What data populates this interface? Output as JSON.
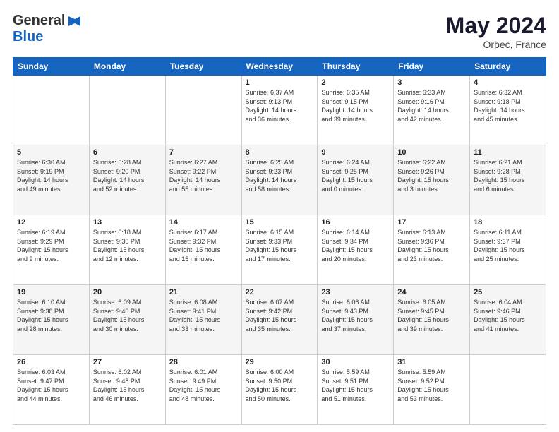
{
  "header": {
    "logo_general": "General",
    "logo_blue": "Blue",
    "month": "May 2024",
    "location": "Orbec, France"
  },
  "days_of_week": [
    "Sunday",
    "Monday",
    "Tuesday",
    "Wednesday",
    "Thursday",
    "Friday",
    "Saturday"
  ],
  "weeks": [
    [
      {
        "num": "",
        "detail": ""
      },
      {
        "num": "",
        "detail": ""
      },
      {
        "num": "",
        "detail": ""
      },
      {
        "num": "1",
        "detail": "Sunrise: 6:37 AM\nSunset: 9:13 PM\nDaylight: 14 hours\nand 36 minutes."
      },
      {
        "num": "2",
        "detail": "Sunrise: 6:35 AM\nSunset: 9:15 PM\nDaylight: 14 hours\nand 39 minutes."
      },
      {
        "num": "3",
        "detail": "Sunrise: 6:33 AM\nSunset: 9:16 PM\nDaylight: 14 hours\nand 42 minutes."
      },
      {
        "num": "4",
        "detail": "Sunrise: 6:32 AM\nSunset: 9:18 PM\nDaylight: 14 hours\nand 45 minutes."
      }
    ],
    [
      {
        "num": "5",
        "detail": "Sunrise: 6:30 AM\nSunset: 9:19 PM\nDaylight: 14 hours\nand 49 minutes."
      },
      {
        "num": "6",
        "detail": "Sunrise: 6:28 AM\nSunset: 9:20 PM\nDaylight: 14 hours\nand 52 minutes."
      },
      {
        "num": "7",
        "detail": "Sunrise: 6:27 AM\nSunset: 9:22 PM\nDaylight: 14 hours\nand 55 minutes."
      },
      {
        "num": "8",
        "detail": "Sunrise: 6:25 AM\nSunset: 9:23 PM\nDaylight: 14 hours\nand 58 minutes."
      },
      {
        "num": "9",
        "detail": "Sunrise: 6:24 AM\nSunset: 9:25 PM\nDaylight: 15 hours\nand 0 minutes."
      },
      {
        "num": "10",
        "detail": "Sunrise: 6:22 AM\nSunset: 9:26 PM\nDaylight: 15 hours\nand 3 minutes."
      },
      {
        "num": "11",
        "detail": "Sunrise: 6:21 AM\nSunset: 9:28 PM\nDaylight: 15 hours\nand 6 minutes."
      }
    ],
    [
      {
        "num": "12",
        "detail": "Sunrise: 6:19 AM\nSunset: 9:29 PM\nDaylight: 15 hours\nand 9 minutes."
      },
      {
        "num": "13",
        "detail": "Sunrise: 6:18 AM\nSunset: 9:30 PM\nDaylight: 15 hours\nand 12 minutes."
      },
      {
        "num": "14",
        "detail": "Sunrise: 6:17 AM\nSunset: 9:32 PM\nDaylight: 15 hours\nand 15 minutes."
      },
      {
        "num": "15",
        "detail": "Sunrise: 6:15 AM\nSunset: 9:33 PM\nDaylight: 15 hours\nand 17 minutes."
      },
      {
        "num": "16",
        "detail": "Sunrise: 6:14 AM\nSunset: 9:34 PM\nDaylight: 15 hours\nand 20 minutes."
      },
      {
        "num": "17",
        "detail": "Sunrise: 6:13 AM\nSunset: 9:36 PM\nDaylight: 15 hours\nand 23 minutes."
      },
      {
        "num": "18",
        "detail": "Sunrise: 6:11 AM\nSunset: 9:37 PM\nDaylight: 15 hours\nand 25 minutes."
      }
    ],
    [
      {
        "num": "19",
        "detail": "Sunrise: 6:10 AM\nSunset: 9:38 PM\nDaylight: 15 hours\nand 28 minutes."
      },
      {
        "num": "20",
        "detail": "Sunrise: 6:09 AM\nSunset: 9:40 PM\nDaylight: 15 hours\nand 30 minutes."
      },
      {
        "num": "21",
        "detail": "Sunrise: 6:08 AM\nSunset: 9:41 PM\nDaylight: 15 hours\nand 33 minutes."
      },
      {
        "num": "22",
        "detail": "Sunrise: 6:07 AM\nSunset: 9:42 PM\nDaylight: 15 hours\nand 35 minutes."
      },
      {
        "num": "23",
        "detail": "Sunrise: 6:06 AM\nSunset: 9:43 PM\nDaylight: 15 hours\nand 37 minutes."
      },
      {
        "num": "24",
        "detail": "Sunrise: 6:05 AM\nSunset: 9:45 PM\nDaylight: 15 hours\nand 39 minutes."
      },
      {
        "num": "25",
        "detail": "Sunrise: 6:04 AM\nSunset: 9:46 PM\nDaylight: 15 hours\nand 41 minutes."
      }
    ],
    [
      {
        "num": "26",
        "detail": "Sunrise: 6:03 AM\nSunset: 9:47 PM\nDaylight: 15 hours\nand 44 minutes."
      },
      {
        "num": "27",
        "detail": "Sunrise: 6:02 AM\nSunset: 9:48 PM\nDaylight: 15 hours\nand 46 minutes."
      },
      {
        "num": "28",
        "detail": "Sunrise: 6:01 AM\nSunset: 9:49 PM\nDaylight: 15 hours\nand 48 minutes."
      },
      {
        "num": "29",
        "detail": "Sunrise: 6:00 AM\nSunset: 9:50 PM\nDaylight: 15 hours\nand 50 minutes."
      },
      {
        "num": "30",
        "detail": "Sunrise: 5:59 AM\nSunset: 9:51 PM\nDaylight: 15 hours\nand 51 minutes."
      },
      {
        "num": "31",
        "detail": "Sunrise: 5:59 AM\nSunset: 9:52 PM\nDaylight: 15 hours\nand 53 minutes."
      },
      {
        "num": "",
        "detail": ""
      }
    ]
  ]
}
